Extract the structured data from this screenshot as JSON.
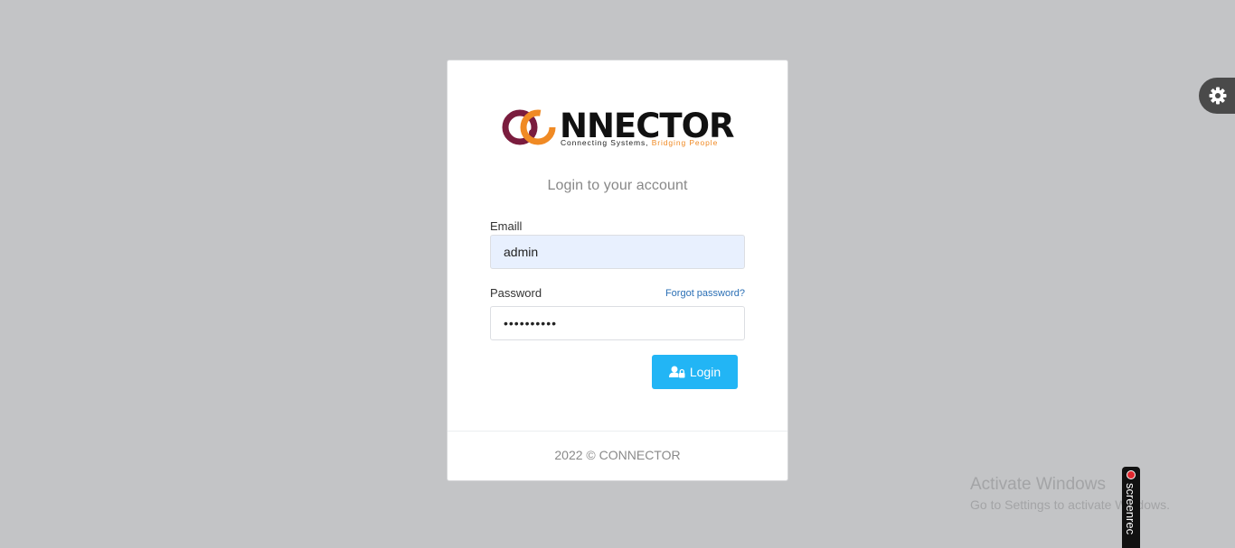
{
  "brand": {
    "name": "NNECTOR",
    "tagline_main": "Connecting Systems, ",
    "tagline_accent": "Bridging People",
    "colors": {
      "ring_dark": "#7a1c3e",
      "ring_orange": "#f08a24"
    }
  },
  "login": {
    "subtitle": "Login to your account",
    "email_label": "Emaill",
    "email_value": "admin",
    "password_label": "Password",
    "password_value": "••••••••••",
    "forgot_link": "Forgot password?",
    "login_button": "Login",
    "login_icon": "user-lock-icon",
    "button_color": "#22b5f5"
  },
  "footer": {
    "text": "2022 © CONNECTOR"
  },
  "settings": {
    "icon": "gear-icon"
  },
  "watermark": {
    "line1": "Activate Windows",
    "line2": "Go to Settings to activate Windows."
  },
  "recorder": {
    "label": "screenrec",
    "icon": "record-icon"
  }
}
